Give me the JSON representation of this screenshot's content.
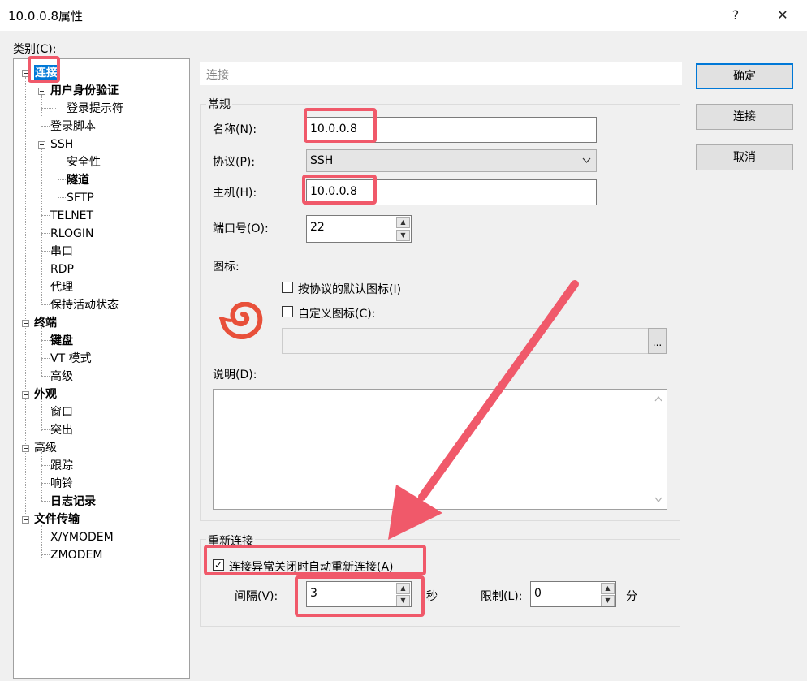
{
  "window": {
    "title": "10.0.0.8属性",
    "help": "?",
    "close": "✕"
  },
  "category_label": "类别(C):",
  "tree": [
    {
      "label": "连接",
      "bold": true,
      "selected": true
    },
    {
      "label": "用户身份验证",
      "bold": true
    },
    {
      "label": "登录提示符"
    },
    {
      "label": "登录脚本"
    },
    {
      "label": "SSH"
    },
    {
      "label": "安全性"
    },
    {
      "label": "隧道",
      "bold": true
    },
    {
      "label": "SFTP"
    },
    {
      "label": "TELNET"
    },
    {
      "label": "RLOGIN"
    },
    {
      "label": "串口"
    },
    {
      "label": "RDP"
    },
    {
      "label": "代理"
    },
    {
      "label": "保持活动状态"
    },
    {
      "label": "终端",
      "bold": true
    },
    {
      "label": "键盘",
      "bold": true
    },
    {
      "label": "VT 模式"
    },
    {
      "label": "高级"
    },
    {
      "label": "外观",
      "bold": true
    },
    {
      "label": "窗口"
    },
    {
      "label": "突出"
    },
    {
      "label": "高级"
    },
    {
      "label": "跟踪"
    },
    {
      "label": "响铃"
    },
    {
      "label": "日志记录",
      "bold": true
    },
    {
      "label": "文件传输",
      "bold": true
    },
    {
      "label": "X/YMODEM"
    },
    {
      "label": "ZMODEM"
    }
  ],
  "section_header": "连接",
  "general": {
    "title": "常规",
    "name_label": "名称(N):",
    "name_value": "10.0.0.8",
    "protocol_label": "协议(P):",
    "protocol_value": "SSH",
    "host_label": "主机(H):",
    "host_value": "10.0.0.8",
    "port_label": "端口号(O):",
    "port_value": "22",
    "icon_label": "图标:",
    "default_icon_label": "按协议的默认图标(I)",
    "custom_icon_label": "自定义图标(C):",
    "browse_label": "...",
    "desc_label": "说明(D):"
  },
  "reconnect": {
    "title": "重新连接",
    "auto_label": "连接异常关闭时自动重新连接(A)",
    "interval_label": "间隔(V):",
    "interval_value": "3",
    "interval_unit": "秒",
    "limit_label": "限制(L):",
    "limit_value": "0",
    "limit_unit": "分"
  },
  "buttons": {
    "ok": "确定",
    "connect": "连接",
    "cancel": "取消"
  },
  "colors": {
    "annotation": "#f0596a",
    "selection": "#0078d7"
  }
}
